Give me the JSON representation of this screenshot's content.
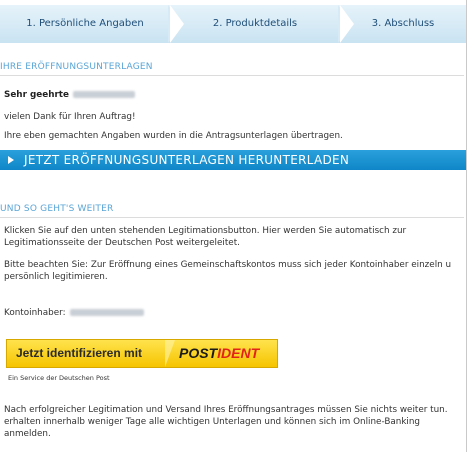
{
  "steps": [
    {
      "label": "1. Persönliche Angaben"
    },
    {
      "label": "2. Produktdetails"
    },
    {
      "label": "3. Abschluss"
    }
  ],
  "section1": {
    "title": "IHRE ERÖFFNUNGSUNTERLAGEN",
    "greeting": "Sehr geehrte",
    "thanks": "vielen Dank für Ihren Auftrag!",
    "transferred": "Ihre eben gemachten Angaben wurden in die Antragsunterlagen übertragen."
  },
  "download": {
    "label": "JETZT ERÖFFNUNGSUNTERLAGEN HERUNTERLADEN"
  },
  "section2": {
    "title": "UND SO GEHT'S WEITER",
    "para1_line1": "Klicken Sie auf den unten stehenden Legitimationsbutton. Hier werden Sie automatisch zur",
    "para1_line2": "Legitimationsseite der Deutschen Post weitergeleitet.",
    "para2_line1": "Bitte beachten Sie: Zur Eröffnung eines Gemeinschaftskontos muss sich jeder Kontoinhaber einzeln u",
    "para2_line2": "persönlich legitimieren.",
    "account_holder_label": "Kontoinhaber:",
    "postident": {
      "left_label": "Jetzt identifizieren mit",
      "brand_post": "POST",
      "brand_ident": "IDENT"
    },
    "service_note": "Ein Service der Deutschen Post",
    "para3_line1": "Nach erfolgreicher Legitimation und Versand Ihres Eröffnungsantrages müssen Sie nichts weiter tun.",
    "para3_line2": "erhalten innerhalb weniger Tage alle wichtigen Unterlagen und können sich im Online-Banking",
    "para3_line3": "anmelden."
  },
  "colors": {
    "accent": "#1a8fd0",
    "section_title": "#5aa5d6",
    "postident_yellow": "#f6c400",
    "postident_red": "#e2231a"
  }
}
